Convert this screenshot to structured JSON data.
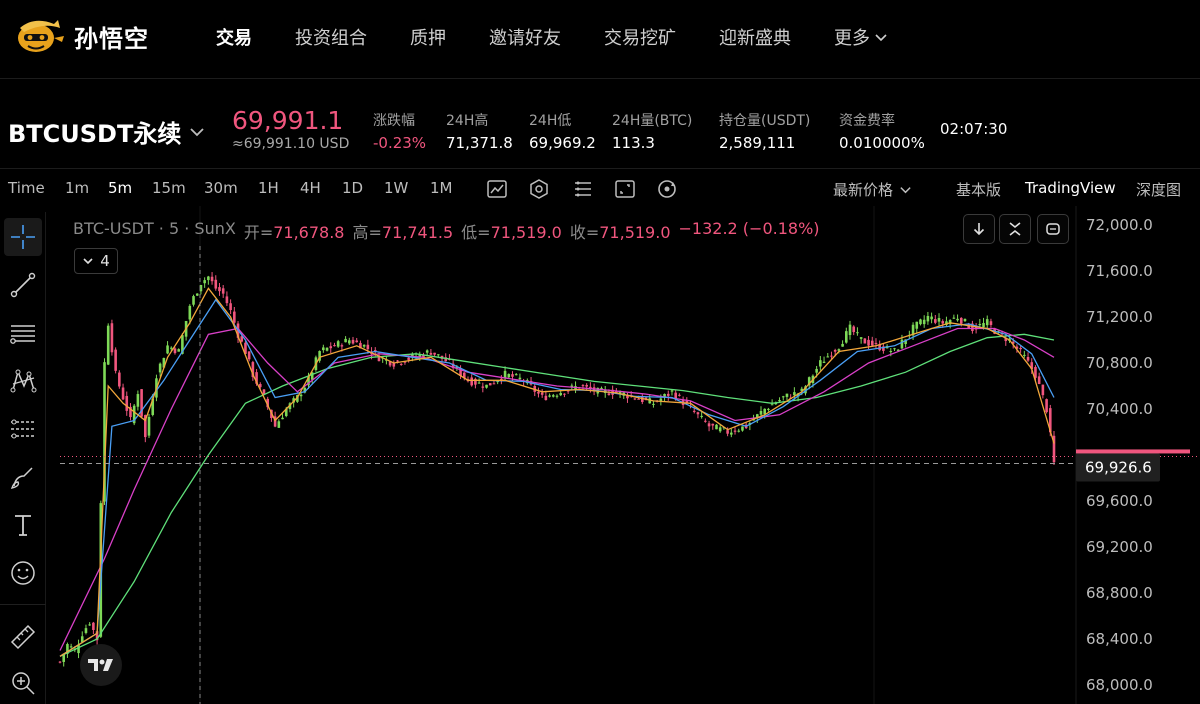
{
  "brand": {
    "name": "孙悟空"
  },
  "nav": {
    "items": [
      "交易",
      "投资组合",
      "质押",
      "邀请好友",
      "交易挖矿",
      "迎新盛典"
    ],
    "more": "更多"
  },
  "ticker": {
    "symbol": "BTCUSDT永续",
    "last_price": "69,991.1",
    "usd_price": "≈69,991.10 USD",
    "stats": [
      {
        "label": "涨跌幅",
        "value": "-0.23%"
      },
      {
        "label": "24H高",
        "value": "71,371.8"
      },
      {
        "label": "24H低",
        "value": "69,969.2"
      },
      {
        "label": "24H量(BTC)",
        "value": "113.3"
      },
      {
        "label": "持仓量(USDT)",
        "value": "2,589,111"
      },
      {
        "label": "资金费率",
        "value": "0.010000%"
      }
    ],
    "clock": "02:07:30"
  },
  "toolbar": {
    "time_label": "Time",
    "intervals": [
      "1m",
      "5m",
      "15m",
      "30m",
      "1H",
      "4H",
      "1D",
      "1W",
      "1M"
    ],
    "active_interval": "5m",
    "price_type": "最新价格",
    "views": [
      "基本版",
      "TradingView",
      "深度图"
    ],
    "active_view": "TradingView"
  },
  "legend": {
    "symbol": "BTC-USDT · 5 · SunX",
    "open_label": "开=",
    "open": "71,678.8",
    "high_label": "高=",
    "high": "71,741.5",
    "low_label": "低=",
    "low": "71,519.0",
    "close_label": "收=",
    "close": "71,519.0",
    "change": "−132.2 (−0.18%)",
    "indicator_count": "4"
  },
  "colors": {
    "up": "#7ed957",
    "down": "#f0567e",
    "accent": "#f0567e",
    "ma_fast": "#f2a73b",
    "ma_mid": "#4a9ff5",
    "ma_slow": "#d940c8",
    "ma_long": "#5fe07a"
  },
  "chart_data": {
    "type": "candlestick",
    "interval": "5m",
    "y_ticks": [
      "72,000.0",
      "71,600.0",
      "71,200.0",
      "70,800.0",
      "70,400.0",
      "69,600.0",
      "69,200.0",
      "68,800.0",
      "68,400.0",
      "68,000.0"
    ],
    "ylim": [
      68000,
      72000
    ],
    "current_price_label": "69,926.6",
    "current_price": 69926.6,
    "close_path": [
      [
        0,
        68200
      ],
      [
        2,
        68350
      ],
      [
        4,
        68300
      ],
      [
        6,
        68450
      ],
      [
        8,
        68550
      ],
      [
        10,
        68400
      ],
      [
        12,
        70800
      ],
      [
        13,
        71150
      ],
      [
        15,
        70700
      ],
      [
        17,
        70500
      ],
      [
        19,
        70300
      ],
      [
        21,
        70550
      ],
      [
        23,
        70150
      ],
      [
        26,
        70700
      ],
      [
        29,
        70950
      ],
      [
        32,
        70900
      ],
      [
        35,
        71300
      ],
      [
        38,
        71500
      ],
      [
        40,
        71550
      ],
      [
        42,
        71450
      ],
      [
        44,
        71400
      ],
      [
        46,
        71250
      ],
      [
        48,
        71050
      ],
      [
        50,
        70900
      ],
      [
        52,
        70700
      ],
      [
        55,
        70500
      ],
      [
        58,
        70250
      ],
      [
        61,
        70400
      ],
      [
        64,
        70500
      ],
      [
        67,
        70650
      ],
      [
        70,
        70900
      ],
      [
        74,
        70950
      ],
      [
        78,
        71000
      ],
      [
        82,
        70950
      ],
      [
        86,
        70850
      ],
      [
        90,
        70800
      ],
      [
        95,
        70850
      ],
      [
        100,
        70900
      ],
      [
        105,
        70800
      ],
      [
        110,
        70650
      ],
      [
        115,
        70600
      ],
      [
        120,
        70700
      ],
      [
        125,
        70650
      ],
      [
        130,
        70500
      ],
      [
        135,
        70550
      ],
      [
        140,
        70600
      ],
      [
        145,
        70550
      ],
      [
        150,
        70550
      ],
      [
        155,
        70500
      ],
      [
        160,
        70450
      ],
      [
        165,
        70550
      ],
      [
        170,
        70400
      ],
      [
        175,
        70250
      ],
      [
        180,
        70200
      ],
      [
        185,
        70250
      ],
      [
        190,
        70400
      ],
      [
        195,
        70500
      ],
      [
        200,
        70550
      ],
      [
        205,
        70800
      ],
      [
        210,
        70950
      ],
      [
        213,
        71100
      ],
      [
        216,
        71000
      ],
      [
        220,
        70950
      ],
      [
        225,
        70900
      ],
      [
        230,
        71100
      ],
      [
        234,
        71200
      ],
      [
        238,
        71150
      ],
      [
        242,
        71200
      ],
      [
        246,
        71100
      ],
      [
        250,
        71150
      ],
      [
        253,
        71050
      ],
      [
        256,
        71000
      ],
      [
        260,
        70850
      ],
      [
        263,
        70700
      ],
      [
        266,
        70400
      ],
      [
        268,
        69926.6
      ]
    ],
    "ma_fast_path": [
      [
        0,
        68250
      ],
      [
        10,
        68450
      ],
      [
        13,
        70600
      ],
      [
        17,
        70450
      ],
      [
        23,
        70300
      ],
      [
        29,
        70850
      ],
      [
        35,
        71150
      ],
      [
        40,
        71450
      ],
      [
        46,
        71200
      ],
      [
        52,
        70700
      ],
      [
        58,
        70300
      ],
      [
        64,
        70500
      ],
      [
        70,
        70850
      ],
      [
        80,
        70950
      ],
      [
        90,
        70800
      ],
      [
        100,
        70850
      ],
      [
        110,
        70650
      ],
      [
        120,
        70650
      ],
      [
        130,
        70550
      ],
      [
        140,
        70570
      ],
      [
        150,
        70540
      ],
      [
        160,
        70470
      ],
      [
        170,
        70450
      ],
      [
        180,
        70220
      ],
      [
        190,
        70350
      ],
      [
        200,
        70550
      ],
      [
        210,
        70900
      ],
      [
        220,
        70950
      ],
      [
        230,
        71050
      ],
      [
        240,
        71150
      ],
      [
        250,
        71100
      ],
      [
        256,
        71000
      ],
      [
        262,
        70750
      ],
      [
        268,
        70100
      ]
    ],
    "ma_mid_path": [
      [
        0,
        68250
      ],
      [
        10,
        68450
      ],
      [
        14,
        70250
      ],
      [
        20,
        70300
      ],
      [
        28,
        70650
      ],
      [
        35,
        71000
      ],
      [
        42,
        71350
      ],
      [
        50,
        71000
      ],
      [
        58,
        70500
      ],
      [
        66,
        70550
      ],
      [
        75,
        70850
      ],
      [
        85,
        70900
      ],
      [
        95,
        70850
      ],
      [
        105,
        70800
      ],
      [
        115,
        70650
      ],
      [
        125,
        70640
      ],
      [
        135,
        70570
      ],
      [
        145,
        70560
      ],
      [
        155,
        70510
      ],
      [
        165,
        70500
      ],
      [
        175,
        70350
      ],
      [
        185,
        70250
      ],
      [
        195,
        70420
      ],
      [
        205,
        70650
      ],
      [
        215,
        70900
      ],
      [
        225,
        70950
      ],
      [
        235,
        71100
      ],
      [
        245,
        71140
      ],
      [
        255,
        71050
      ],
      [
        262,
        70880
      ],
      [
        268,
        70500
      ]
    ],
    "ma_slow_path": [
      [
        0,
        68300
      ],
      [
        12,
        69100
      ],
      [
        20,
        69700
      ],
      [
        30,
        70400
      ],
      [
        40,
        71050
      ],
      [
        48,
        71100
      ],
      [
        56,
        70800
      ],
      [
        64,
        70550
      ],
      [
        74,
        70800
      ],
      [
        86,
        70880
      ],
      [
        98,
        70850
      ],
      [
        110,
        70720
      ],
      [
        122,
        70660
      ],
      [
        134,
        70600
      ],
      [
        146,
        70570
      ],
      [
        158,
        70530
      ],
      [
        170,
        70470
      ],
      [
        182,
        70300
      ],
      [
        194,
        70350
      ],
      [
        206,
        70550
      ],
      [
        218,
        70800
      ],
      [
        230,
        70950
      ],
      [
        242,
        71100
      ],
      [
        252,
        71100
      ],
      [
        260,
        71000
      ],
      [
        268,
        70850
      ]
    ],
    "ma_long_path": [
      [
        0,
        68250
      ],
      [
        10,
        68400
      ],
      [
        20,
        68900
      ],
      [
        30,
        69500
      ],
      [
        40,
        70000
      ],
      [
        50,
        70450
      ],
      [
        60,
        70600
      ],
      [
        72,
        70750
      ],
      [
        84,
        70850
      ],
      [
        96,
        70880
      ],
      [
        108,
        70820
      ],
      [
        120,
        70760
      ],
      [
        132,
        70700
      ],
      [
        144,
        70640
      ],
      [
        156,
        70600
      ],
      [
        168,
        70560
      ],
      [
        180,
        70500
      ],
      [
        192,
        70450
      ],
      [
        204,
        70500
      ],
      [
        216,
        70600
      ],
      [
        228,
        70720
      ],
      [
        240,
        70900
      ],
      [
        250,
        71020
      ],
      [
        260,
        71050
      ],
      [
        268,
        71000
      ]
    ]
  }
}
